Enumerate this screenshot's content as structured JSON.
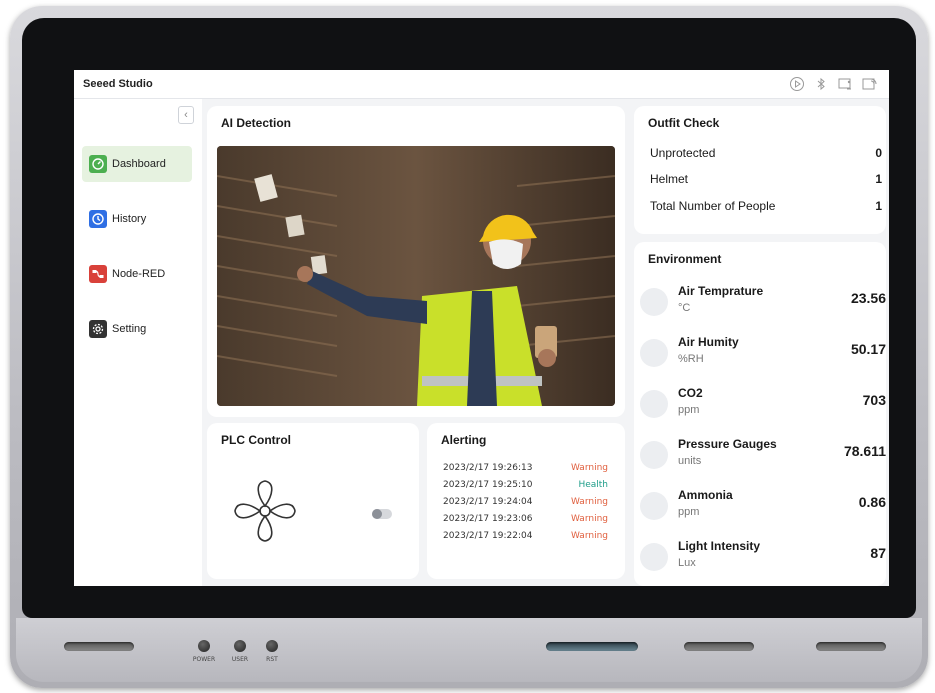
{
  "app": {
    "brand": "Seeed Studio"
  },
  "topbar": {
    "icons": [
      "play-icon",
      "bluetooth-icon",
      "wifi-screen-icon",
      "signal-icon"
    ]
  },
  "sidebar": {
    "items": [
      {
        "label": "Dashboard",
        "icon": "dashboard-icon",
        "active": true,
        "color": "#4caf50"
      },
      {
        "label": "History",
        "icon": "history-icon",
        "active": false,
        "color": "#2f6fe4"
      },
      {
        "label": "Node-RED",
        "icon": "node-red-icon",
        "active": false,
        "color": "#d9413a"
      },
      {
        "label": "Setting",
        "icon": "gear-icon",
        "active": false,
        "color": "#333333"
      }
    ]
  },
  "ai_detection": {
    "title": "AI Detection"
  },
  "outfit": {
    "title": "Outfit Check",
    "rows": [
      {
        "label": "Unprotected",
        "value": "0"
      },
      {
        "label": "Helmet",
        "value": "1"
      },
      {
        "label": "Total Number of People",
        "value": "1"
      }
    ]
  },
  "environment": {
    "title": "Environment",
    "rows": [
      {
        "name": "Air Temprature",
        "unit": "°C",
        "value": "23.56"
      },
      {
        "name": "Air Humity",
        "unit": "%RH",
        "value": "50.17"
      },
      {
        "name": "CO2",
        "unit": "ppm",
        "value": "703"
      },
      {
        "name": "Pressure Gauges",
        "unit": "units",
        "value": "78.611"
      },
      {
        "name": "Ammonia",
        "unit": "ppm",
        "value": "0.86"
      },
      {
        "name": "Light Intensity",
        "unit": "Lux",
        "value": "87"
      }
    ]
  },
  "plc": {
    "title": "PLC Control",
    "toggle_on": false
  },
  "alerting": {
    "title": "Alerting",
    "rows": [
      {
        "time": "2023/2/17 19:26:13",
        "status": "Warning",
        "color": "#e0603f"
      },
      {
        "time": "2023/2/17 19:25:10",
        "status": "Health",
        "color": "#1f9e8a"
      },
      {
        "time": "2023/2/17 19:24:04",
        "status": "Warning",
        "color": "#e0603f"
      },
      {
        "time": "2023/2/17 19:23:06",
        "status": "Warning",
        "color": "#e0603f"
      },
      {
        "time": "2023/2/17 19:22:04",
        "status": "Warning",
        "color": "#e0603f"
      }
    ]
  },
  "device": {
    "buttons": [
      "POWER",
      "USER",
      "RST"
    ]
  }
}
